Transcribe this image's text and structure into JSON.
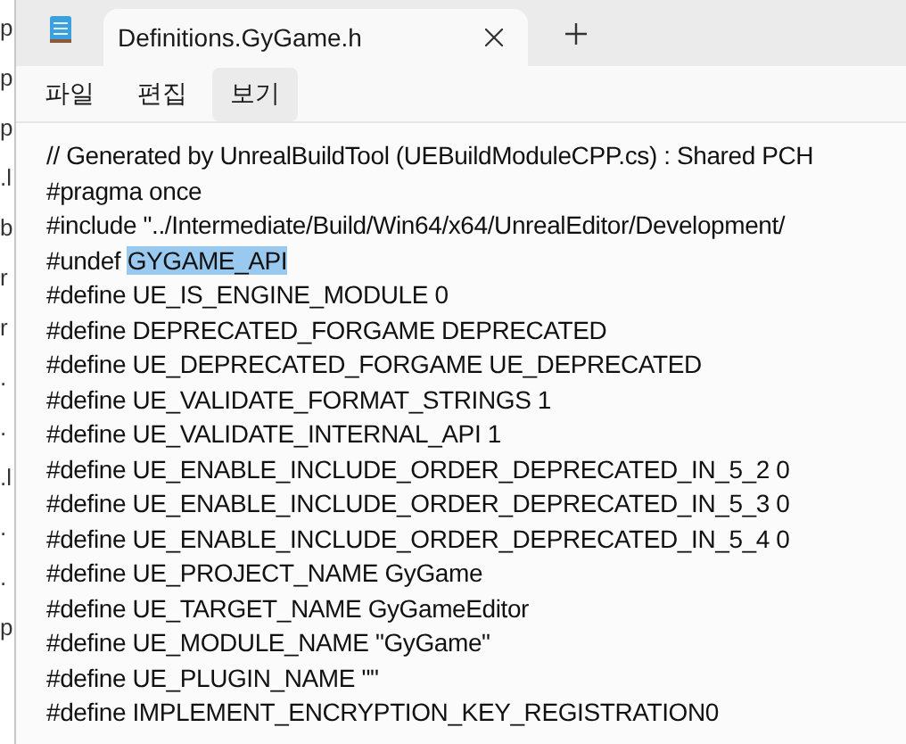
{
  "background_window": {
    "fragments": [
      "p",
      "p",
      "p",
      ".l",
      "b",
      "r",
      "r",
      ".",
      ".",
      ".l",
      ".",
      ".",
      "p"
    ]
  },
  "tabs": [
    {
      "title": "Definitions.GyGame.h",
      "selected": true
    }
  ],
  "menu": [
    {
      "label": "파일",
      "selected": false
    },
    {
      "label": "편집",
      "selected": false
    },
    {
      "label": "보기",
      "selected": true
    }
  ],
  "editor": {
    "lines": [
      {
        "parts": [
          {
            "text": "// Generated by UnrealBuildTool (UEBuildModuleCPP.cs) : Shared PCH",
            "selected": false
          }
        ]
      },
      {
        "parts": [
          {
            "text": "#pragma once",
            "selected": false
          }
        ]
      },
      {
        "parts": [
          {
            "text": "#include \"../Intermediate/Build/Win64/x64/UnrealEditor/Development/",
            "selected": false
          }
        ]
      },
      {
        "parts": [
          {
            "text": "#undef ",
            "selected": false
          },
          {
            "text": "GYGAME_API",
            "selected": true
          }
        ]
      },
      {
        "parts": [
          {
            "text": "#define UE_IS_ENGINE_MODULE 0",
            "selected": false
          }
        ]
      },
      {
        "parts": [
          {
            "text": "#define DEPRECATED_FORGAME DEPRECATED",
            "selected": false
          }
        ]
      },
      {
        "parts": [
          {
            "text": "#define UE_DEPRECATED_FORGAME UE_DEPRECATED",
            "selected": false
          }
        ]
      },
      {
        "parts": [
          {
            "text": "#define UE_VALIDATE_FORMAT_STRINGS 1",
            "selected": false
          }
        ]
      },
      {
        "parts": [
          {
            "text": "#define UE_VALIDATE_INTERNAL_API 1",
            "selected": false
          }
        ]
      },
      {
        "parts": [
          {
            "text": "#define UE_ENABLE_INCLUDE_ORDER_DEPRECATED_IN_5_2 0",
            "selected": false
          }
        ]
      },
      {
        "parts": [
          {
            "text": "#define UE_ENABLE_INCLUDE_ORDER_DEPRECATED_IN_5_3 0",
            "selected": false
          }
        ]
      },
      {
        "parts": [
          {
            "text": "#define UE_ENABLE_INCLUDE_ORDER_DEPRECATED_IN_5_4 0",
            "selected": false
          }
        ]
      },
      {
        "parts": [
          {
            "text": "#define UE_PROJECT_NAME GyGame",
            "selected": false
          }
        ]
      },
      {
        "parts": [
          {
            "text": "#define UE_TARGET_NAME GyGameEditor",
            "selected": false
          }
        ]
      },
      {
        "parts": [
          {
            "text": "#define UE_MODULE_NAME \"GyGame\"",
            "selected": false
          }
        ]
      },
      {
        "parts": [
          {
            "text": "#define UE_PLUGIN_NAME \"\"",
            "selected": false
          }
        ]
      },
      {
        "parts": [
          {
            "text": "#define IMPLEMENT_ENCRYPTION_KEY_REGISTRATION0",
            "selected": false
          }
        ]
      }
    ]
  }
}
